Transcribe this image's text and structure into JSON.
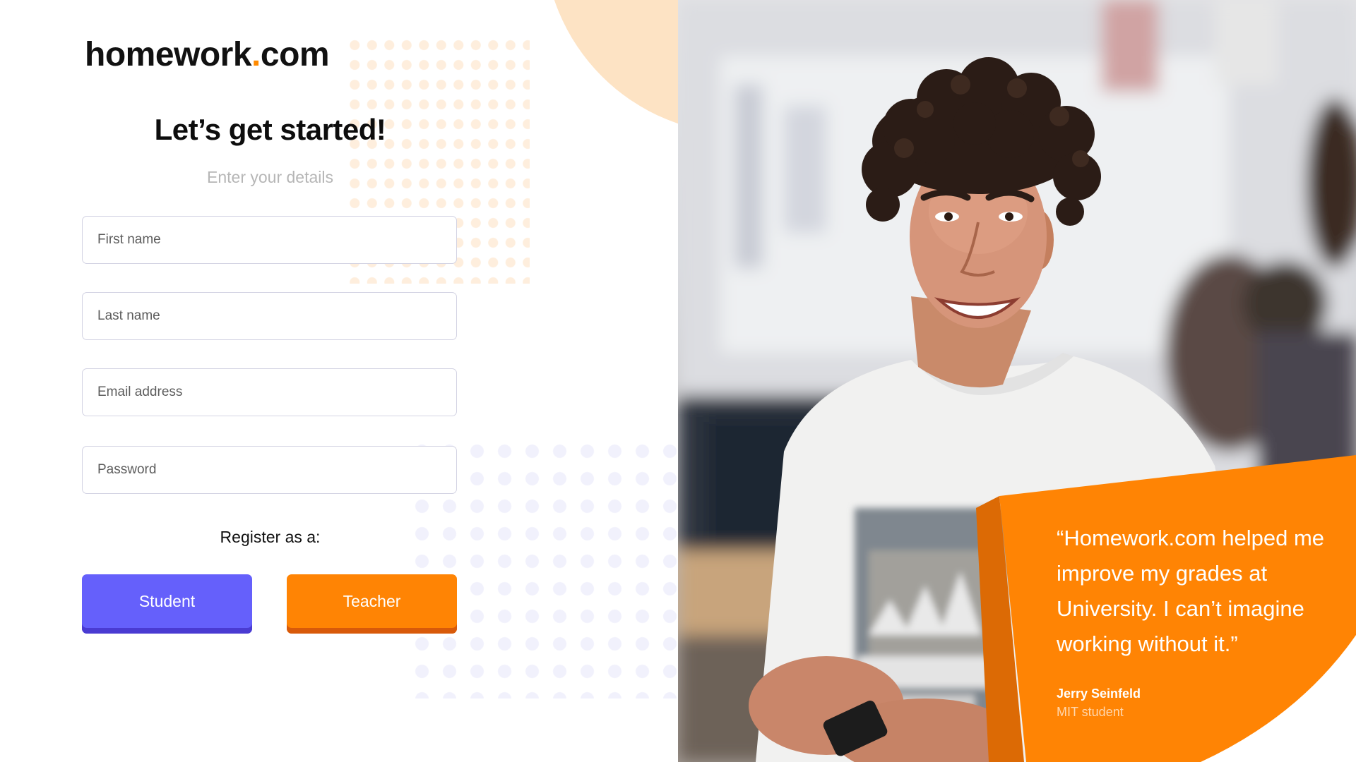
{
  "brand": {
    "name": "homework",
    "dot": ".",
    "tld": "com"
  },
  "form": {
    "title": "Let’s get started!",
    "subtitle": "Enter your details",
    "first_name_placeholder": "First name",
    "last_name_placeholder": "Last name",
    "email_placeholder": "Email address",
    "password_placeholder": "Password",
    "register_label": "Register as a:",
    "student_label": "Student",
    "teacher_label": "Teacher"
  },
  "testimonial": {
    "quote": "“Homework.com helped me improve my grades at University. I can’t imagine working without it.”",
    "author": "Jerry Seinfeld",
    "role": "MIT student"
  },
  "colors": {
    "accent_orange": "#ff8404",
    "accent_purple": "#6560fb",
    "peach": "#fde3c4"
  },
  "icons": {
    "hero_photo": "smiling-student-photo"
  }
}
